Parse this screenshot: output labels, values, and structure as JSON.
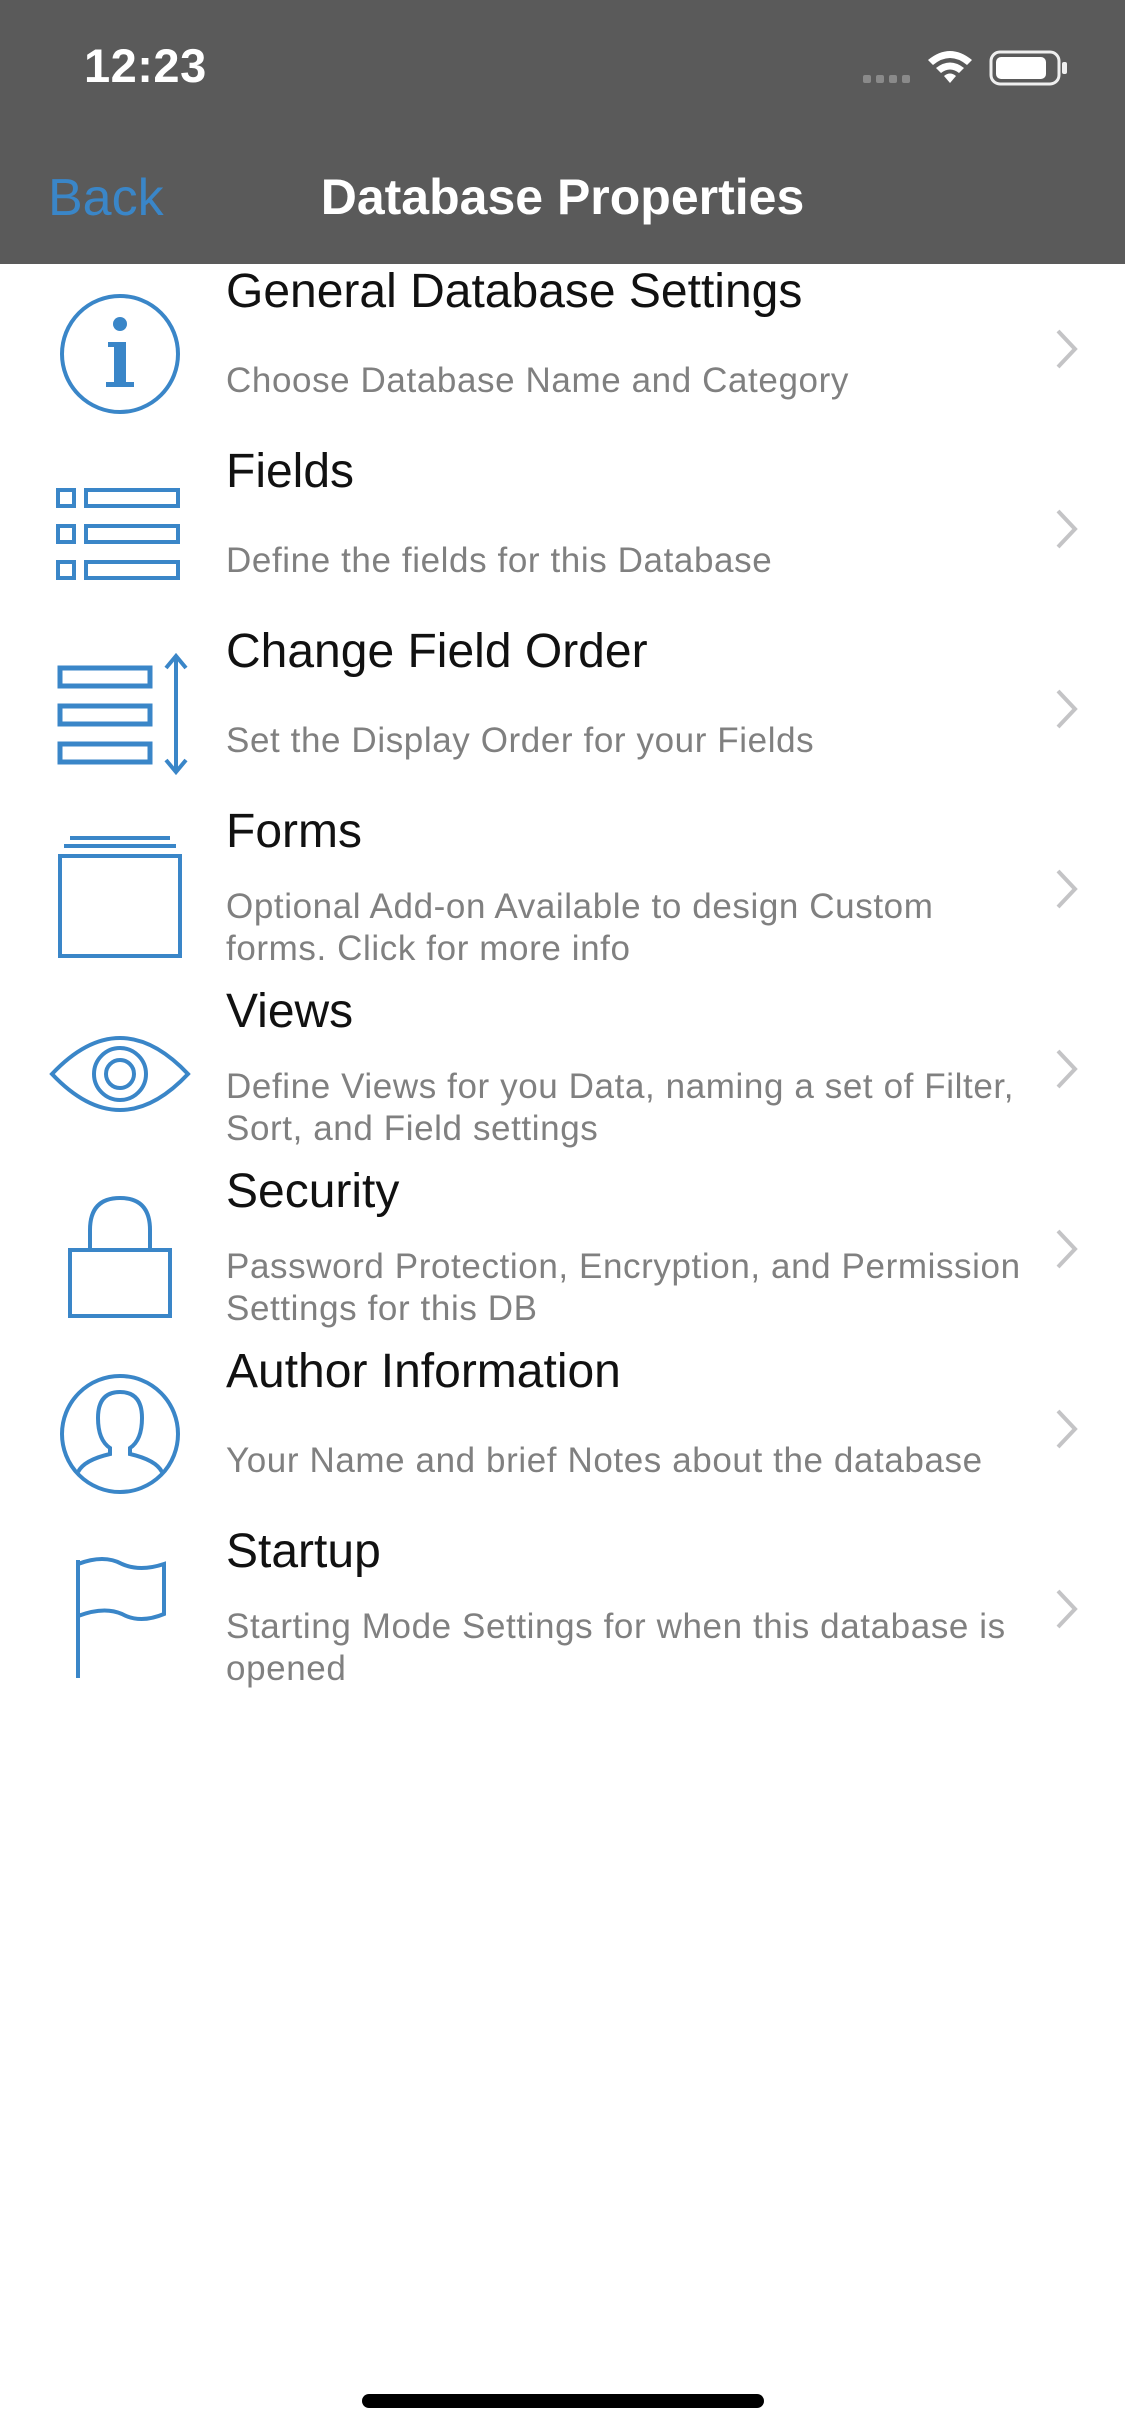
{
  "status_bar": {
    "time": "12:23"
  },
  "nav": {
    "back_label": "Back",
    "title": "Database Properties"
  },
  "colors": {
    "accent": "#3a86c8",
    "header_bg": "#5a5a5a",
    "title_text": "#111111",
    "subtitle_text": "#808080",
    "chevron": "#c4c4c6"
  },
  "items": [
    {
      "icon": "info-icon",
      "title": "General Database Settings",
      "subtitle": "Choose Database Name and Category"
    },
    {
      "icon": "list-icon",
      "title": "Fields",
      "subtitle": "Define the fields for this Database"
    },
    {
      "icon": "reorder-icon",
      "title": "Change Field Order",
      "subtitle": "Set the Display Order for your Fields"
    },
    {
      "icon": "forms-icon",
      "title": "Forms",
      "subtitle": "Optional Add-on Available to design Custom forms.  Click for more info"
    },
    {
      "icon": "eye-icon",
      "title": "Views",
      "subtitle": "Define Views for you Data, naming a set of Filter, Sort, and Field settings"
    },
    {
      "icon": "lock-icon",
      "title": "Security",
      "subtitle": "Password Protection, Encryption, and Permission Settings for this DB"
    },
    {
      "icon": "user-icon",
      "title": "Author Information",
      "subtitle": "Your Name and brief Notes about the database"
    },
    {
      "icon": "flag-icon",
      "title": "Startup",
      "subtitle": "Starting Mode Settings for when this database is opened"
    }
  ]
}
